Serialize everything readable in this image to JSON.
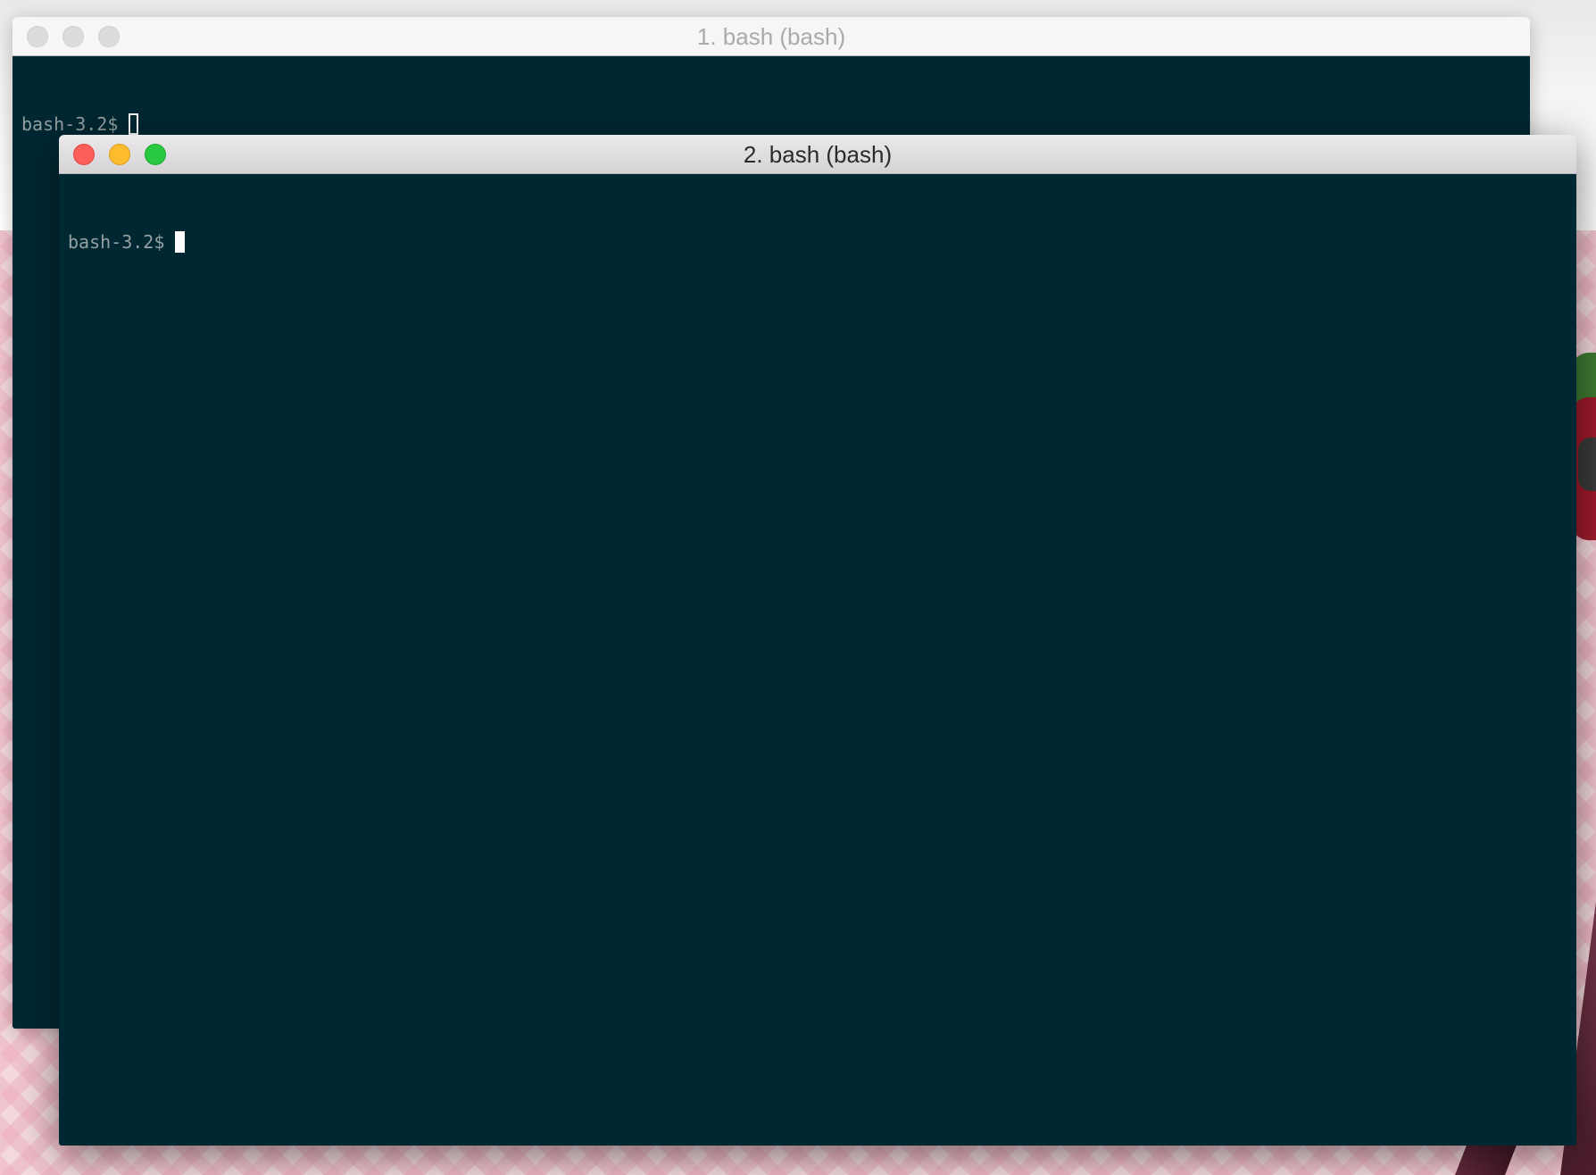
{
  "windows": [
    {
      "title": "1. bash (bash)",
      "state": "inactive",
      "lines": [
        {
          "prompt": "bash-3.2$",
          "cursor": "hollow-block"
        }
      ]
    },
    {
      "title": "2. bash (bash)",
      "state": "active",
      "lines": [
        {
          "prompt": "bash-3.2$",
          "cursor": "solid-block"
        }
      ]
    }
  ],
  "colors": {
    "terminal_background": "#002833",
    "prompt_text": "#93a1a1",
    "close": "#fc5f57",
    "minimize": "#fdbc2e",
    "zoom": "#28c840"
  },
  "icons": {
    "close": "close-icon",
    "minimize": "minimize-icon",
    "zoom": "zoom-icon",
    "cursor": "cursor-icon"
  }
}
